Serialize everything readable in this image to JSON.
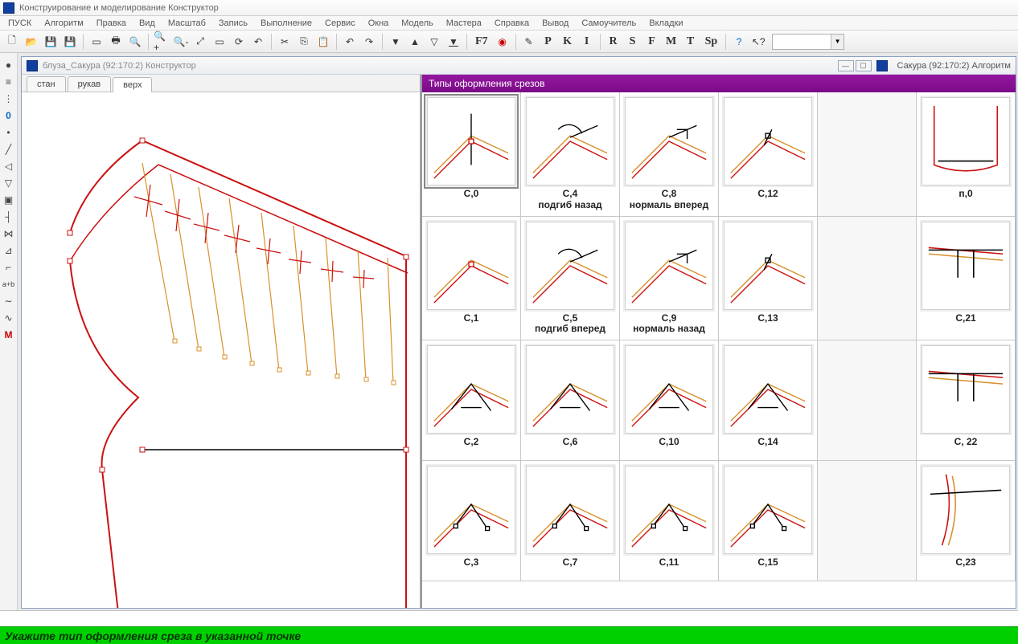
{
  "app_title": "Конструирование и моделирование  Конструктор",
  "menu": [
    "ПУСК",
    "Алгоритм",
    "Правка",
    "Вид",
    "Масштаб",
    "Запись",
    "Выполнение",
    "Сервис",
    "Окна",
    "Модель",
    "Мастера",
    "Справка",
    "Вывод",
    "Самоучитель",
    "Вкладки"
  ],
  "toolbar_letters": {
    "f7": "F7",
    "p": "P",
    "k": "K",
    "i": "I",
    "r": "R",
    "s": "S",
    "f": "F",
    "m": "M",
    "t": "T",
    "sp": "Sp"
  },
  "mdi": {
    "title": "блуза_Сакура  (92:170:2)  Конструктор",
    "right_label": "Сакура (92:170:2) Алгоритм"
  },
  "tabs": [
    "стан",
    "рукав",
    "верх"
  ],
  "active_tab": 2,
  "right_panel_title": "Типы оформления срезов",
  "cells": [
    {
      "cap": "С,0",
      "sel": true
    },
    {
      "cap": "С,4\nподгиб назад"
    },
    {
      "cap": "С,8\nнормаль вперед"
    },
    {
      "cap": "С,12"
    },
    {
      "cap": ""
    },
    {
      "cap": "п,0"
    },
    {
      "cap": "С,1"
    },
    {
      "cap": "С,5\nподгиб вперед"
    },
    {
      "cap": "С,9\nнормаль назад"
    },
    {
      "cap": "С,13"
    },
    {
      "cap": ""
    },
    {
      "cap": "С,21"
    },
    {
      "cap": "С,2"
    },
    {
      "cap": "С,6"
    },
    {
      "cap": "С,10"
    },
    {
      "cap": "С,14"
    },
    {
      "cap": ""
    },
    {
      "cap": "С, 22"
    },
    {
      "cap": "С,3"
    },
    {
      "cap": "С,7"
    },
    {
      "cap": "С,11"
    },
    {
      "cap": "С,15"
    },
    {
      "cap": ""
    },
    {
      "cap": "С,23"
    }
  ],
  "left_tools": [
    "●",
    "≡",
    "⋮",
    "0",
    "•",
    "╱",
    "◁",
    "▽",
    "▣",
    "┤",
    "⋈",
    "⊿",
    "⌐",
    "a+b",
    "∼",
    "∿",
    "M"
  ],
  "status": "Укажите тип оформления среза в указанной точке"
}
